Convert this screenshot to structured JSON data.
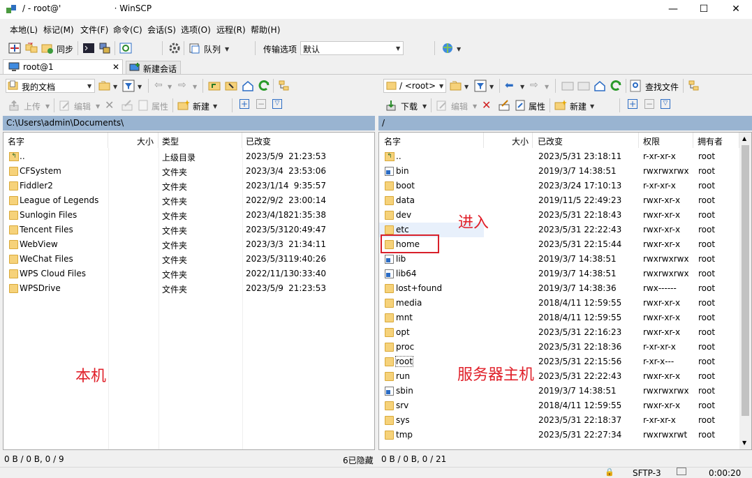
{
  "window": {
    "title": "/ - root@'                    · WinSCP",
    "minimize": "—",
    "maximize": "☐",
    "close": "✕"
  },
  "menu": [
    "本地(L)",
    "标记(M)",
    "文件(F)",
    "命令(C)",
    "会话(S)",
    "选项(O)",
    "远程(R)",
    "帮助(H)"
  ],
  "toolbar1": {
    "sync_label": "同步",
    "queue_label": "队列",
    "transfer_label": "传输选项",
    "transfer_value": "默认"
  },
  "tabs": {
    "active": "root@1",
    "active_close": "✕",
    "new_session": "新建会话"
  },
  "local": {
    "location": "我的文档",
    "upload": "上传",
    "edit": "编辑",
    "properties": "属性",
    "new": "新建",
    "path": "C:\\Users\\admin\\Documents\\",
    "columns": [
      "名字",
      "大小",
      "类型",
      "已改变"
    ],
    "rows": [
      {
        "name": "..",
        "type": "上级目录",
        "date": "2023/5/9",
        "time": "21:23:53"
      },
      {
        "name": "CFSystem",
        "type": "文件夹",
        "date": "2023/3/4",
        "time": "23:53:06"
      },
      {
        "name": "Fiddler2",
        "type": "文件夹",
        "date": "2023/1/14",
        "time": "9:35:57"
      },
      {
        "name": "League of Legends",
        "type": "文件夹",
        "date": "2022/9/2",
        "time": "23:00:14"
      },
      {
        "name": "Sunlogin Files",
        "type": "文件夹",
        "date": "2023/4/18",
        "time": "21:35:38"
      },
      {
        "name": "Tencent Files",
        "type": "文件夹",
        "date": "2023/5/31",
        "time": "20:49:47"
      },
      {
        "name": "WebView",
        "type": "文件夹",
        "date": "2023/3/3",
        "time": "21:34:11"
      },
      {
        "name": "WeChat Files",
        "type": "文件夹",
        "date": "2023/5/31",
        "time": "19:40:26"
      },
      {
        "name": "WPS Cloud Files",
        "type": "文件夹",
        "date": "2022/11/13",
        "time": "0:33:40"
      },
      {
        "name": "WPSDrive",
        "type": "文件夹",
        "date": "2023/5/9",
        "time": "21:23:53"
      }
    ],
    "status_left": "0 B / 0 B,  0 / 9",
    "status_right": "6已隐藏"
  },
  "remote": {
    "location": "/ <root>",
    "download": "下载",
    "edit": "编辑",
    "properties": "属性",
    "new": "新建",
    "find_files": "查找文件",
    "path": "/",
    "columns": [
      "名字",
      "大小",
      "已改变",
      "权限",
      "拥有者"
    ],
    "rows": [
      {
        "name": "..",
        "icon": "up",
        "changed": "2023/5/31 23:18:11",
        "rights": "r-xr-xr-x",
        "owner": "root"
      },
      {
        "name": "bin",
        "icon": "link",
        "changed": "2019/3/7 14:38:51",
        "rights": "rwxrwxrwx",
        "owner": "root"
      },
      {
        "name": "boot",
        "icon": "folder",
        "changed": "2023/3/24 17:10:13",
        "rights": "r-xr-xr-x",
        "owner": "root"
      },
      {
        "name": "data",
        "icon": "folder",
        "changed": "2019/11/5 22:49:23",
        "rights": "rwxr-xr-x",
        "owner": "root"
      },
      {
        "name": "dev",
        "icon": "folder",
        "changed": "2023/5/31 22:18:43",
        "rights": "rwxr-xr-x",
        "owner": "root"
      },
      {
        "name": "etc",
        "icon": "folder",
        "changed": "2023/5/31 22:22:43",
        "rights": "rwxr-xr-x",
        "owner": "root"
      },
      {
        "name": "home",
        "icon": "folder",
        "changed": "2023/5/31 22:15:44",
        "rights": "rwxr-xr-x",
        "owner": "root"
      },
      {
        "name": "lib",
        "icon": "link",
        "changed": "2019/3/7 14:38:51",
        "rights": "rwxrwxrwx",
        "owner": "root"
      },
      {
        "name": "lib64",
        "icon": "link",
        "changed": "2019/3/7 14:38:51",
        "rights": "rwxrwxrwx",
        "owner": "root"
      },
      {
        "name": "lost+found",
        "icon": "folder",
        "changed": "2019/3/7 14:38:36",
        "rights": "rwx------",
        "owner": "root"
      },
      {
        "name": "media",
        "icon": "folder",
        "changed": "2018/4/11 12:59:55",
        "rights": "rwxr-xr-x",
        "owner": "root"
      },
      {
        "name": "mnt",
        "icon": "folder",
        "changed": "2018/4/11 12:59:55",
        "rights": "rwxr-xr-x",
        "owner": "root"
      },
      {
        "name": "opt",
        "icon": "folder",
        "changed": "2023/5/31 22:16:23",
        "rights": "rwxr-xr-x",
        "owner": "root"
      },
      {
        "name": "proc",
        "icon": "folder",
        "changed": "2023/5/31 22:18:36",
        "rights": "r-xr-xr-x",
        "owner": "root"
      },
      {
        "name": "root",
        "icon": "folder",
        "changed": "2023/5/31 22:15:56",
        "rights": "r-xr-x---",
        "owner": "root"
      },
      {
        "name": "run",
        "icon": "folder",
        "changed": "2023/5/31 22:22:43",
        "rights": "rwxr-xr-x",
        "owner": "root"
      },
      {
        "name": "sbin",
        "icon": "link",
        "changed": "2019/3/7 14:38:51",
        "rights": "rwxrwxrwx",
        "owner": "root"
      },
      {
        "name": "srv",
        "icon": "folder",
        "changed": "2018/4/11 12:59:55",
        "rights": "rwxr-xr-x",
        "owner": "root"
      },
      {
        "name": "sys",
        "icon": "folder",
        "changed": "2023/5/31 22:18:37",
        "rights": "r-xr-xr-x",
        "owner": "root"
      },
      {
        "name": "tmp",
        "icon": "folder",
        "changed": "2023/5/31 22:27:34",
        "rights": "rwxrwxrwt",
        "owner": "root"
      }
    ],
    "status_left": "0 B / 0 B,  0 / 21"
  },
  "statusbar": {
    "protocol": "SFTP-3",
    "elapsed": "0:00:20"
  },
  "annotations": {
    "enter": "进入",
    "local_machine": "本机",
    "server_host": "服务器主机"
  },
  "colors": {
    "path_bar": "#99b4d1",
    "annotation": "#e0202a",
    "folder": "#f6d27a"
  }
}
